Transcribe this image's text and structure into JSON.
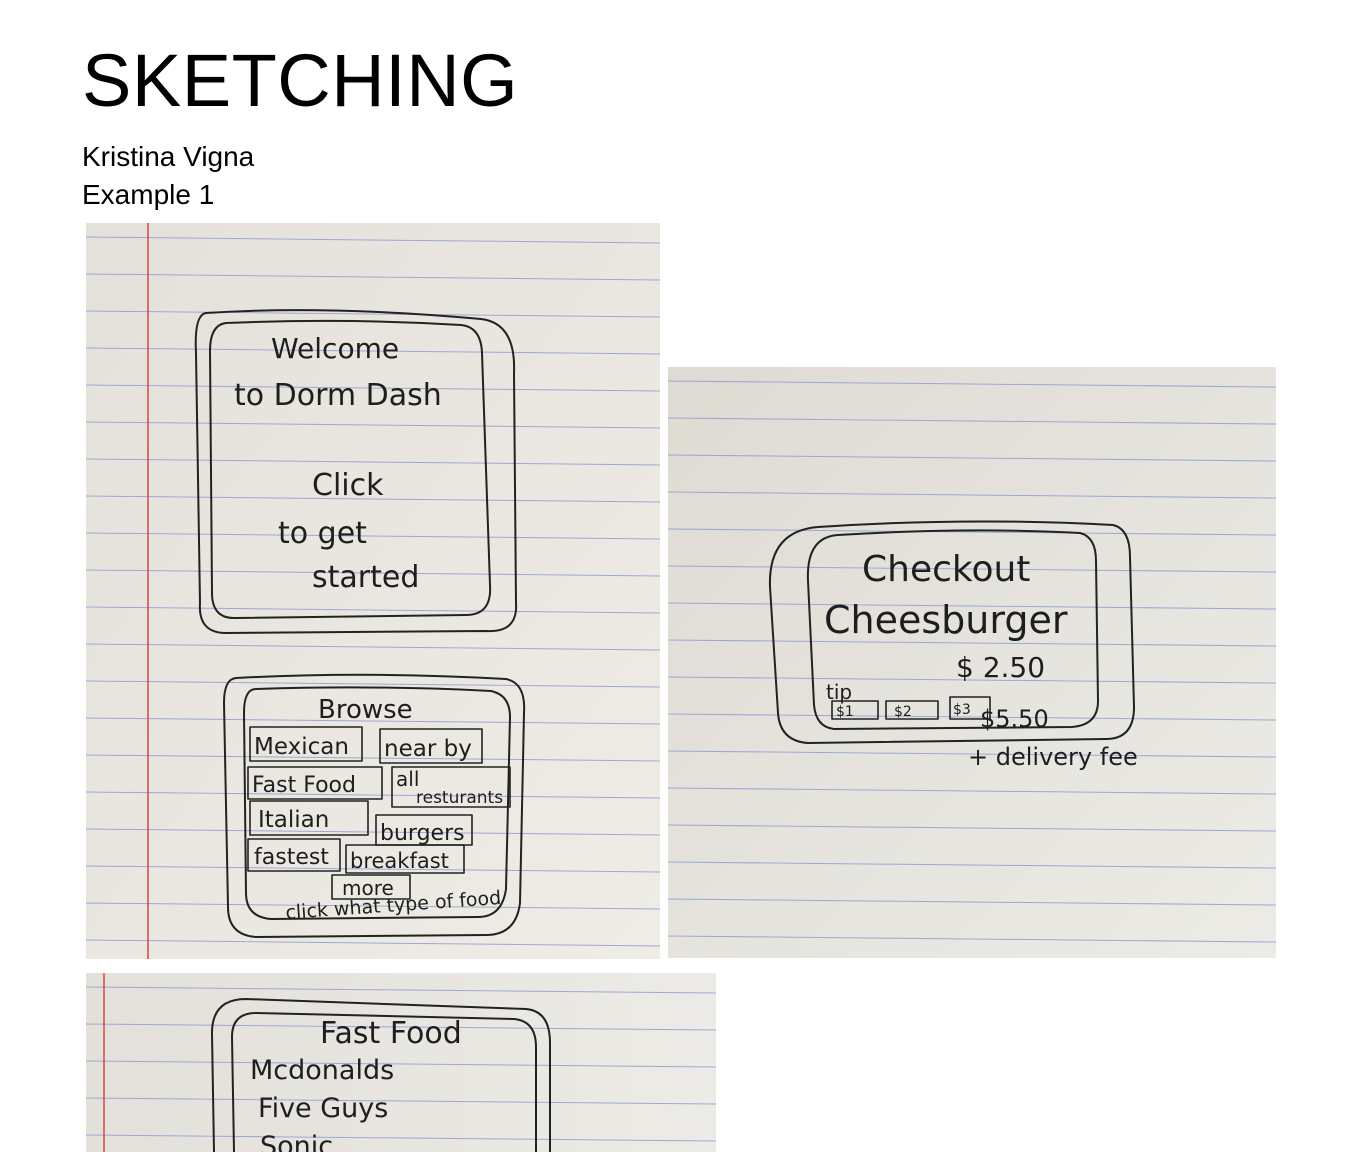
{
  "document": {
    "title": "SKETCHING",
    "author": "Kristina Vigna",
    "example_label": "Example 1"
  },
  "sketches": {
    "welcome": {
      "line1": "Welcome",
      "line2": "to Dorm Dash",
      "line3": "Click",
      "line4": "to get",
      "line5": "started"
    },
    "browse": {
      "title": "Browse",
      "options": [
        "Mexican",
        "near by",
        "Fast Food",
        "all",
        "resturants",
        "Italian",
        "burgers",
        "fastest",
        "breakfast",
        "more"
      ],
      "hint": "click what type of food"
    },
    "checkout": {
      "title": "Checkout",
      "item": "Cheesburger",
      "price": "$ 2.50",
      "tip_label": "tip",
      "tip_options": [
        "$1",
        "$2",
        "$3"
      ],
      "total": "$5.50",
      "delivery_note": "+ delivery fee"
    },
    "fast_food": {
      "title": "Fast Food",
      "items": [
        "Mcdonalds",
        "Five Guys",
        "Sonic"
      ]
    }
  },
  "colors": {
    "paper": "#e9e6df",
    "rule_line": "#8e9ed6",
    "margin_line": "#d9424b",
    "ink": "#1e1e1e"
  }
}
